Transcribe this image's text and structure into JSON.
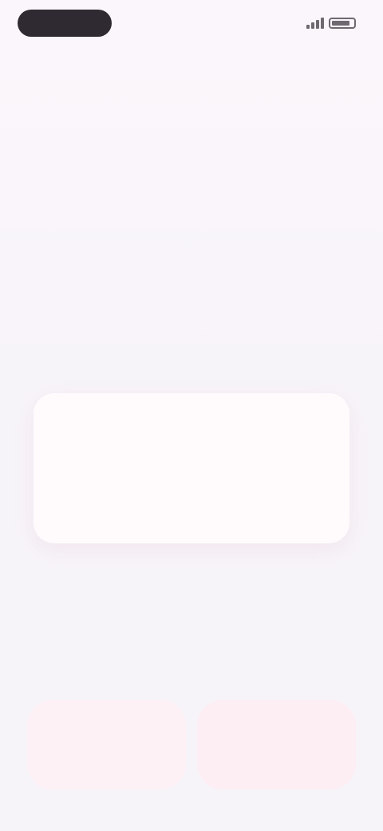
{
  "status_bar": {
    "time": "",
    "icons": [
      "signal-icon",
      "battery-icon"
    ]
  },
  "header": {
    "title": ""
  },
  "question": {
    "text": ""
  },
  "answer": {
    "text": ""
  },
  "controls": {
    "left_label": "",
    "right_label": ""
  },
  "colors": {
    "accent": "#f1b9cf",
    "card": "#fffbfd",
    "button": "#fdf1f6",
    "text": "#3b3640"
  }
}
